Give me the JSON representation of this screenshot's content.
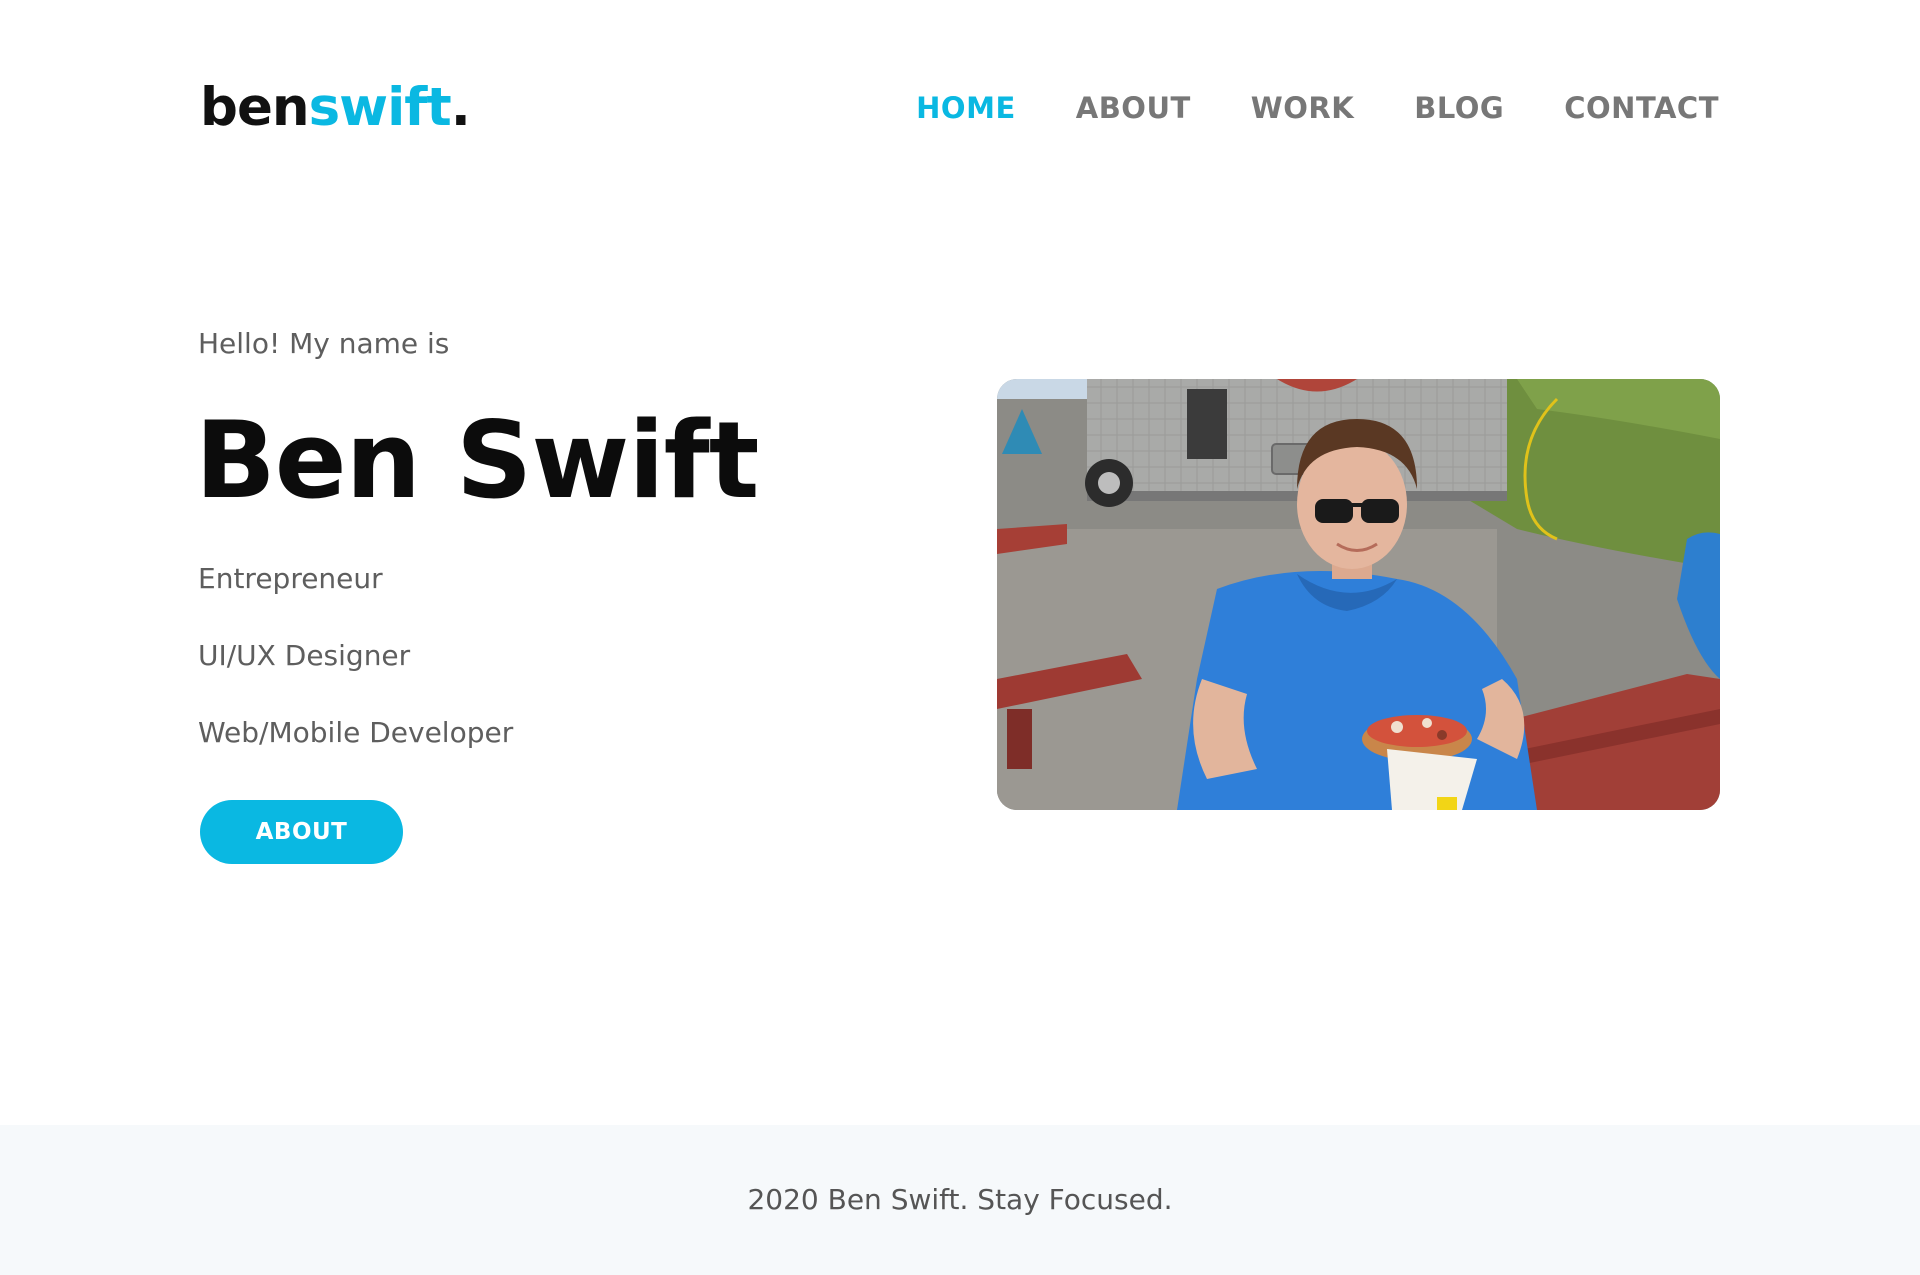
{
  "header": {
    "logo": {
      "part1": "ben",
      "part2": "swift",
      "part3": "."
    },
    "nav": [
      {
        "label": "HOME",
        "active": true
      },
      {
        "label": "ABOUT",
        "active": false
      },
      {
        "label": "WORK",
        "active": false
      },
      {
        "label": "BLOG",
        "active": false
      },
      {
        "label": "CONTACT",
        "active": false
      }
    ]
  },
  "hero": {
    "greeting": "Hello! My name is",
    "name": "Ben Swift",
    "roles": [
      "Entrepreneur",
      "UI/UX Designer",
      "Web/Mobile Developer"
    ],
    "button_label": "ABOUT",
    "photo_alt": "Ben Swift eating at a picnic table by a food truck"
  },
  "footer": {
    "text": "2020 Ben Swift. Stay Focused."
  },
  "colors": {
    "accent": "#0ab8e2",
    "nav_inactive": "#777777",
    "text_muted": "#5e5e5e",
    "footer_bg": "#f6f9fb"
  }
}
